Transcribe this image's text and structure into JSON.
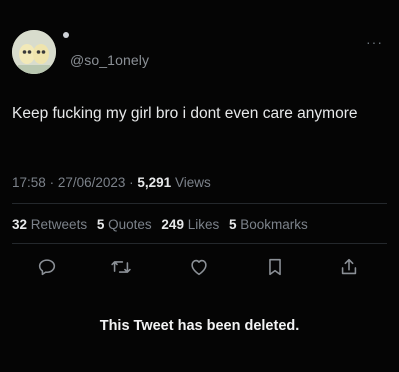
{
  "tweet": {
    "handle": "@so_1onely",
    "text": "Keep fucking my girl bro i dont even care anymore",
    "time": "17:58",
    "date": "27/06/2023",
    "views_count": "5,291",
    "views_label": "Views",
    "more_label": "···"
  },
  "stats": {
    "retweets_count": "32",
    "retweets_label": "Retweets",
    "quotes_count": "5",
    "quotes_label": "Quotes",
    "likes_count": "249",
    "likes_label": "Likes",
    "bookmarks_count": "5",
    "bookmarks_label": "Bookmarks"
  },
  "actions": {
    "icons": [
      "reply-icon",
      "retweet-icon",
      "like-icon",
      "bookmark-icon",
      "share-icon"
    ],
    "icon_color": "#8b9096"
  },
  "notice": {
    "deleted_text": "This Tweet has been deleted."
  }
}
